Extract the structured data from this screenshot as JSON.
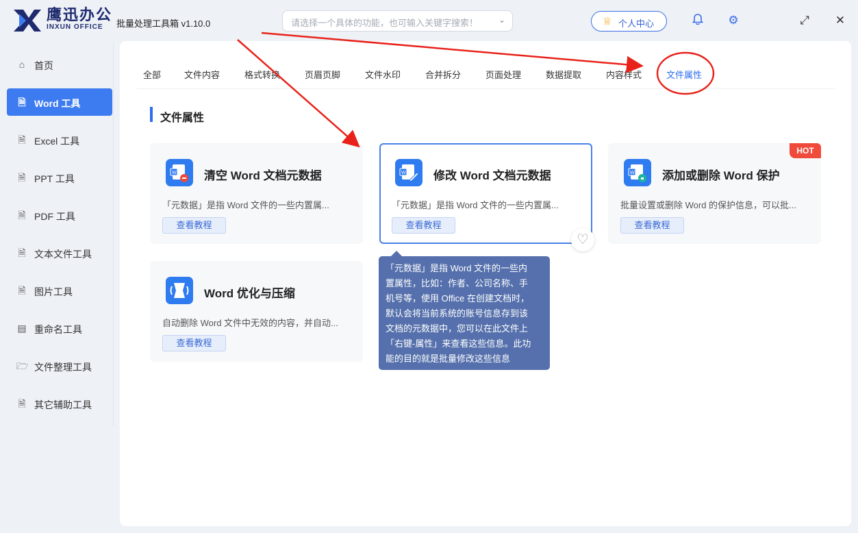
{
  "app": {
    "brand_cn": "鹰迅办公",
    "brand_en": "INXUN OFFICE",
    "title": "批量处理工具箱 v1.10.0",
    "search_placeholder": "请选择一个具体的功能，也可输入关键字搜索！",
    "user_center": "个人中心"
  },
  "sidebar": {
    "items": [
      {
        "label": "首页",
        "icon": "home-icon"
      },
      {
        "label": "Word 工具",
        "icon": "word-file-icon"
      },
      {
        "label": "Excel 工具",
        "icon": "excel-file-icon"
      },
      {
        "label": "PPT 工具",
        "icon": "ppt-file-icon"
      },
      {
        "label": "PDF 工具",
        "icon": "pdf-file-icon"
      },
      {
        "label": "文本文件工具",
        "icon": "text-file-icon"
      },
      {
        "label": "图片工具",
        "icon": "image-file-icon"
      },
      {
        "label": "重命名工具",
        "icon": "rename-icon"
      },
      {
        "label": "文件整理工具",
        "icon": "folder-icon"
      },
      {
        "label": "其它辅助工具",
        "icon": "tools-icon"
      }
    ],
    "active_index": 1
  },
  "tabs": [
    "全部",
    "文件内容",
    "格式转换",
    "页眉页脚",
    "文件水印",
    "合并拆分",
    "页面处理",
    "数据提取",
    "内容样式",
    "文件属性"
  ],
  "active_tab_index": 9,
  "section_title": "文件属性",
  "cards": [
    {
      "title": "清空 Word 文档元数据",
      "desc": "「元数据」是指 Word 文件的一些内置属...",
      "button": "查看教程"
    },
    {
      "title": "修改 Word 文档元数据",
      "desc": "「元数据」是指 Word 文件的一些内置属...",
      "button": "查看教程"
    },
    {
      "title": "添加或删除 Word 保护",
      "desc": "批量设置或删除 Word 的保护信息，可以批...",
      "button": "查看教程",
      "badge": "HOT"
    },
    {
      "title": "Word 优化与压缩",
      "desc": "自动删除 Word 文件中无效的内容，并自动...",
      "button": "查看教程"
    }
  ],
  "tooltip_lines": [
    "「元数据」是指 Word 文件的一些内",
    "置属性，比如：作者、公司名称、手",
    "机号等，使用 Office 在创建文档时，",
    "默认会将当前系统的账号信息存到该",
    "文档的元数据中，您可以在此文件上",
    "「右键-属性」来查看这些信息。此功",
    "能的目的就是批量修改这些信息"
  ],
  "colors": {
    "accent": "#3d7bf0",
    "hot": "#f04b3a",
    "annotation": "#e8221a",
    "tooltip": "#5570ac"
  }
}
